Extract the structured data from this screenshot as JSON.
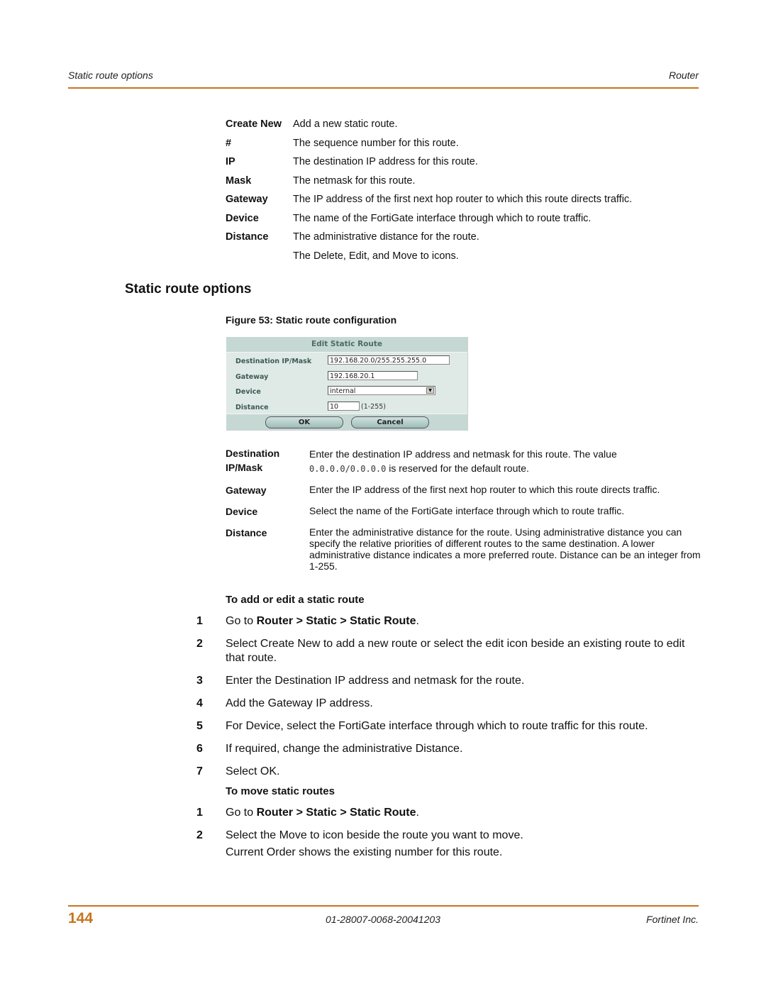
{
  "header": {
    "left": "Static route options",
    "right": "Router"
  },
  "fields_table": [
    {
      "term": "Create New",
      "desc": "Add a new static route."
    },
    {
      "term": "#",
      "desc": "The sequence number for this route."
    },
    {
      "term": "IP",
      "desc": "The destination IP address for this route."
    },
    {
      "term": "Mask",
      "desc": "The netmask for this route."
    },
    {
      "term": "Gateway",
      "desc": "The IP address of the first next hop router to which this route directs traffic."
    },
    {
      "term": "Device",
      "desc": "The name of the FortiGate interface through which to route traffic."
    },
    {
      "term": "Distance",
      "desc": "The administrative distance for the route."
    },
    {
      "term": "",
      "desc": "The Delete, Edit, and Move to icons."
    }
  ],
  "section_title": "Static route options",
  "figure_caption": "Figure 53: Static route configuration",
  "form": {
    "title": "Edit Static Route",
    "dest_label": "Destination IP/Mask",
    "dest_value": "192.168.20.0/255.255.255.0",
    "gateway_label": "Gateway",
    "gateway_value": "192.168.20.1",
    "device_label": "Device",
    "device_value": "internal",
    "distance_label": "Distance",
    "distance_value": "10",
    "distance_hint": "(1-255)",
    "ok_label": "OK",
    "cancel_label": "Cancel"
  },
  "options_table": {
    "dest_term_1": "Destination",
    "dest_term_2": "IP/Mask",
    "dest_desc_1": "Enter the destination IP address and netmask for this route. The value",
    "dest_desc_code": "0.0.0.0/0.0.0.0",
    "dest_desc_2": " is reserved for the default route.",
    "gateway_term": "Gateway",
    "gateway_desc": "Enter the IP address of the first next hop router to which this route directs traffic.",
    "device_term": "Device",
    "device_desc": "Select the name of the FortiGate interface through which to route traffic.",
    "distance_term": "Distance",
    "distance_desc": "Enter the administrative distance for the route. Using administrative distance you can specify the relative priorities of different routes to the same destination. A lower administrative distance indicates a more preferred route. Distance can be an integer from 1-255."
  },
  "proc_add": {
    "title": "To add or edit a static route",
    "step1_pre": "Go to ",
    "step1_bold": "Router > Static > Static Route",
    "step1_post": ".",
    "steps": [
      {
        "num": "2",
        "text": "Select Create New to add a new route or select the edit icon beside an existing route to edit that route."
      },
      {
        "num": "3",
        "text": "Enter the Destination IP address and netmask for the route."
      },
      {
        "num": "4",
        "text": "Add the Gateway IP address."
      },
      {
        "num": "5",
        "text": "For Device, select the FortiGate interface through which to route traffic for this route."
      },
      {
        "num": "6",
        "text": "If required, change the administrative Distance."
      },
      {
        "num": "7",
        "text": "Select OK."
      }
    ]
  },
  "proc_move": {
    "title": "To move static routes",
    "step1_pre": "Go to ",
    "step1_bold": "Router > Static > Static Route",
    "step1_post": ".",
    "step2": "Select the Move to icon beside the route you want to move.",
    "step2_note": "Current Order shows the existing number for this route."
  },
  "footer": {
    "page": "144",
    "doc_id": "01-28007-0068-20041203",
    "company": "Fortinet Inc."
  }
}
